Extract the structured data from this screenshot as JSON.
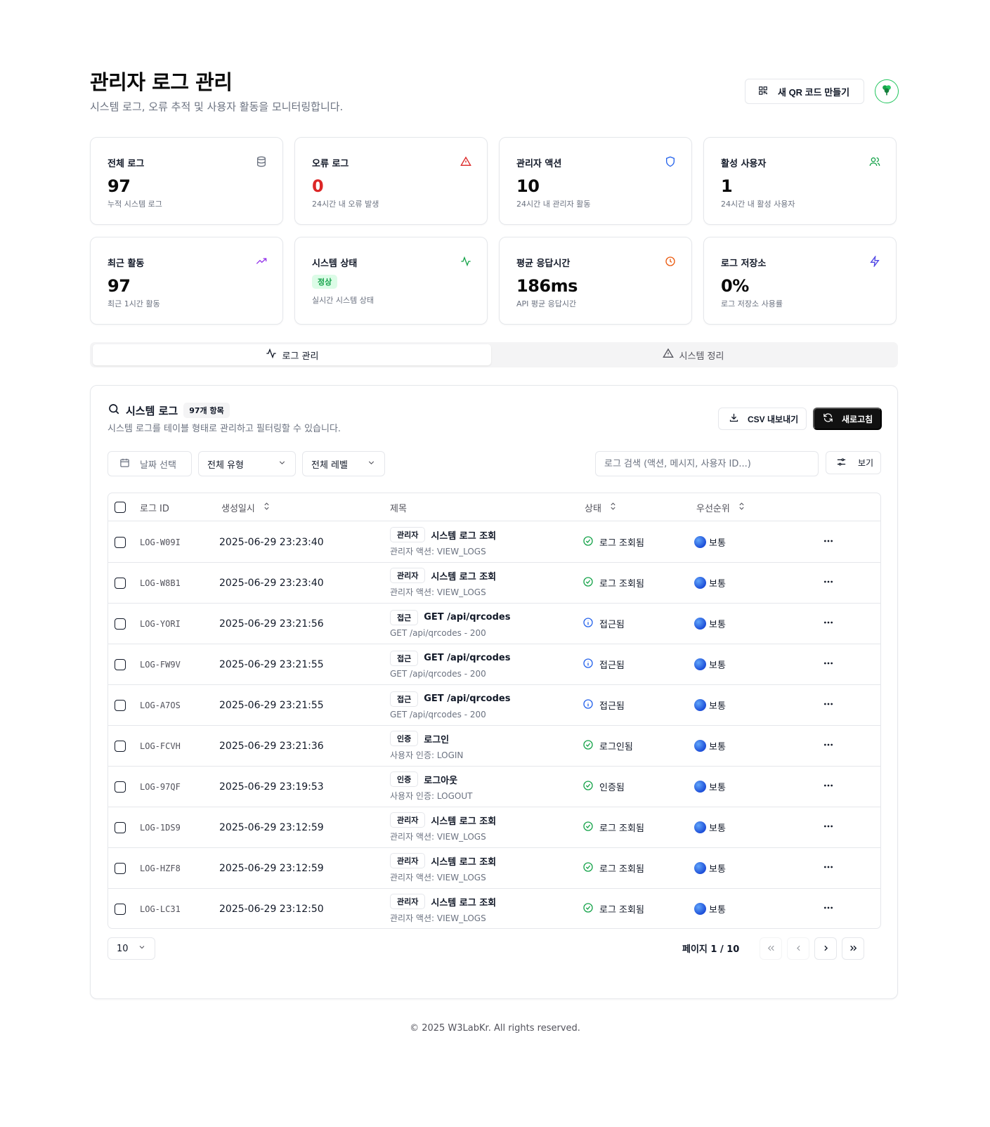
{
  "header": {
    "title": "관리자 로그 관리",
    "subtitle": "시스템 로그, 오류 추적 및 사용자 활동을 모니터링합니다.",
    "qr_button_label": "새 QR 코드 만들기",
    "avatar_icon": "clover-icon"
  },
  "stats": [
    {
      "label": "전체 로그",
      "value": "97",
      "desc": "누적 시스템 로그",
      "icon": "database-icon",
      "color": "#6b7280"
    },
    {
      "label": "오류 로그",
      "value": "0",
      "desc": "24시간 내 오류 발생",
      "icon": "alert-triangle-icon",
      "color": "#dc2626"
    },
    {
      "label": "관리자 액션",
      "value": "10",
      "desc": "24시간 내 관리자 활동",
      "icon": "shield-icon",
      "color": "#2563eb"
    },
    {
      "label": "활성 사용자",
      "value": "1",
      "desc": "24시간 내 활성 사용자",
      "icon": "users-icon",
      "color": "#16a34a"
    },
    {
      "label": "최근 활동",
      "value": "97",
      "desc": "최근 1시간 활동",
      "icon": "trending-up-icon",
      "color": "#9333ea"
    },
    {
      "label": "시스템 상태",
      "badge": "정상",
      "desc": "실시간 시스템 상태",
      "icon": "activity-icon",
      "color": "#16a34a"
    },
    {
      "label": "평균 응답시간",
      "value": "186ms",
      "desc": "API 평균 응답시간",
      "icon": "clock-icon",
      "color": "#ea580c"
    },
    {
      "label": "로그 저장소",
      "value": "0%",
      "desc": "로그 저장소 사용률",
      "icon": "zap-icon",
      "color": "#4f46e5"
    }
  ],
  "tabs": [
    {
      "label": "로그 관리",
      "icon": "activity-icon",
      "active": true
    },
    {
      "label": "시스템 정리",
      "icon": "alert-triangle-icon",
      "active": false
    }
  ],
  "panel": {
    "title": "시스템 로그",
    "count_badge": "97개 항목",
    "description": "시스템 로그를 테이블 형태로 관리하고 필터링할 수 있습니다.",
    "csv_label": "CSV 내보내기",
    "refresh_label": "새로고침",
    "date_filter": "날짜 선택",
    "type_filter": "전체 유형",
    "level_filter": "전체 레벨",
    "search_placeholder": "로그 검색 (액션, 메시지, 사용자 ID...)",
    "view_label": "보기"
  },
  "table": {
    "columns": [
      "로그 ID",
      "생성일시",
      "제목",
      "상태",
      "우선순위"
    ],
    "rows": [
      {
        "id": "LOG-W09I",
        "date": "2025-06-29 23:23:40",
        "tag": "관리자",
        "title": "시스템 로그 조회",
        "sub": "관리자 액션: VIEW_LOGS",
        "status": "로그 조회됨",
        "status_icon": "check-circle-icon",
        "priority": "보통"
      },
      {
        "id": "LOG-W8B1",
        "date": "2025-06-29 23:23:40",
        "tag": "관리자",
        "title": "시스템 로그 조회",
        "sub": "관리자 액션: VIEW_LOGS",
        "status": "로그 조회됨",
        "status_icon": "check-circle-icon",
        "priority": "보통"
      },
      {
        "id": "LOG-YORI",
        "date": "2025-06-29 23:21:56",
        "tag": "접근",
        "title": "GET /api/qrcodes",
        "sub": "GET /api/qrcodes - 200",
        "status": "접근됨",
        "status_icon": "info-icon",
        "priority": "보통"
      },
      {
        "id": "LOG-FW9V",
        "date": "2025-06-29 23:21:55",
        "tag": "접근",
        "title": "GET /api/qrcodes",
        "sub": "GET /api/qrcodes - 200",
        "status": "접근됨",
        "status_icon": "info-icon",
        "priority": "보통"
      },
      {
        "id": "LOG-A7OS",
        "date": "2025-06-29 23:21:55",
        "tag": "접근",
        "title": "GET /api/qrcodes",
        "sub": "GET /api/qrcodes - 200",
        "status": "접근됨",
        "status_icon": "info-icon",
        "priority": "보통"
      },
      {
        "id": "LOG-FCVH",
        "date": "2025-06-29 23:21:36",
        "tag": "인증",
        "title": "로그인",
        "sub": "사용자 인증: LOGIN",
        "status": "로그인됨",
        "status_icon": "check-circle-icon",
        "priority": "보통"
      },
      {
        "id": "LOG-97QF",
        "date": "2025-06-29 23:19:53",
        "tag": "인증",
        "title": "로그아웃",
        "sub": "사용자 인증: LOGOUT",
        "status": "인증됨",
        "status_icon": "check-circle-icon",
        "priority": "보통"
      },
      {
        "id": "LOG-1DS9",
        "date": "2025-06-29 23:12:59",
        "tag": "관리자",
        "title": "시스템 로그 조회",
        "sub": "관리자 액션: VIEW_LOGS",
        "status": "로그 조회됨",
        "status_icon": "check-circle-icon",
        "priority": "보통"
      },
      {
        "id": "LOG-HZF8",
        "date": "2025-06-29 23:12:59",
        "tag": "관리자",
        "title": "시스템 로그 조회",
        "sub": "관리자 액션: VIEW_LOGS",
        "status": "로그 조회됨",
        "status_icon": "check-circle-icon",
        "priority": "보통"
      },
      {
        "id": "LOG-LC31",
        "date": "2025-06-29 23:12:50",
        "tag": "관리자",
        "title": "시스템 로그 조회",
        "sub": "관리자 액션: VIEW_LOGS",
        "status": "로그 조회됨",
        "status_icon": "check-circle-icon",
        "priority": "보통"
      }
    ]
  },
  "pagination": {
    "page_size": "10",
    "page_info": "페이지 1 / 10"
  },
  "footer": {
    "text": "© 2025 W3LabKr. All rights reserved."
  }
}
